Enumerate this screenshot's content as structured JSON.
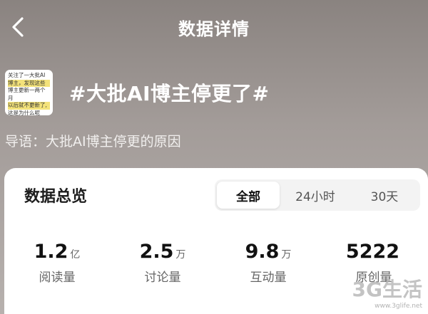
{
  "header": {
    "title": "数据详情",
    "back_icon": "chevron-left-icon"
  },
  "topic": {
    "thumbnail_lines": [
      "关注了一大批AI",
      "博主，发现这些",
      "博主更新一两个月",
      "以后就不更新了,",
      "这是为什么呢"
    ],
    "title": "#大批AI博主停更了#",
    "guide": "导语：大批AI博主停更的原因"
  },
  "overview": {
    "title": "数据总览",
    "tabs": [
      {
        "label": "全部",
        "active": true
      },
      {
        "label": "24小时",
        "active": false
      },
      {
        "label": "30天",
        "active": false
      }
    ],
    "stats": [
      {
        "value": "1.2",
        "unit": "亿",
        "label": "阅读量"
      },
      {
        "value": "2.5",
        "unit": "万",
        "label": "讨论量"
      },
      {
        "value": "9.8",
        "unit": "万",
        "label": "互动量"
      },
      {
        "value": "5222",
        "unit": "",
        "label": "原创量"
      }
    ]
  },
  "watermark": {
    "main": "3G生活",
    "site": "www.3glife.net"
  },
  "colors": {
    "header_bg": "#8a8380",
    "card_bg": "#ffffff",
    "tab_bar_bg": "#f3f3f3",
    "highlight": "#f3e27a"
  }
}
